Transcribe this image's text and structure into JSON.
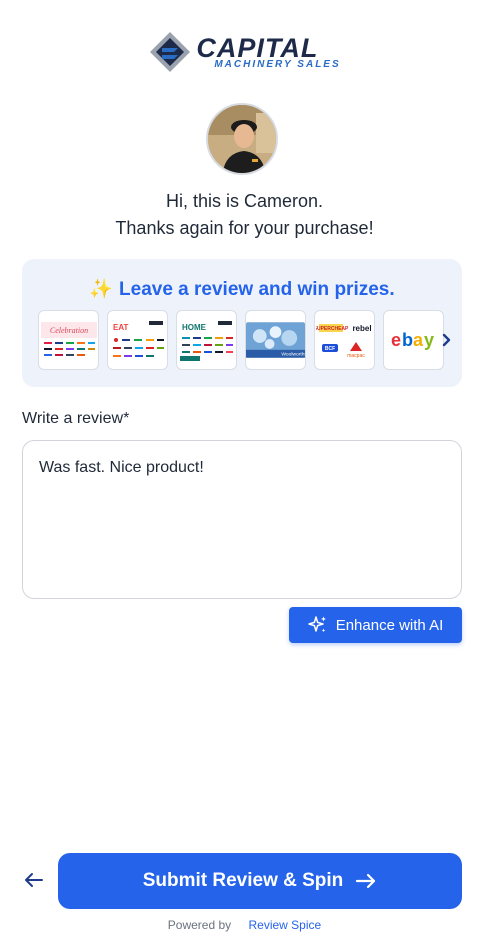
{
  "brand": {
    "logo_word": "CAPITAL",
    "logo_sub": "MACHINERY SALES"
  },
  "greeting": {
    "line1": "Hi, this is Cameron.",
    "line2": "Thanks again for your purchase!"
  },
  "prizes": {
    "heading": "Leave a review and win prizes.",
    "heading_icon": "sparkles-icon",
    "thumbnails": [
      {
        "name": "Celebration",
        "label": "Celebration"
      },
      {
        "name": "EAT",
        "label": "EAT"
      },
      {
        "name": "HOME",
        "label": "HOME"
      },
      {
        "name": "Woolworths",
        "label": "Woolworths"
      },
      {
        "name": "Supercheap / rebel",
        "label": "rebel"
      },
      {
        "name": "ebay",
        "label": "ebay"
      }
    ],
    "next_icon": "chevron-right-icon"
  },
  "review": {
    "label": "Write a review*",
    "value": "Was fast. Nice product!"
  },
  "enhance_button": {
    "label": "Enhance with AI",
    "icon": "sparkles-icon"
  },
  "submit_button": {
    "label": "Submit Review & Spin",
    "icon": "arrow-right-icon"
  },
  "back_button": {
    "icon": "arrow-left-icon"
  },
  "footer": {
    "powered_by": "Powered by",
    "brand": "Review Spice"
  },
  "colors": {
    "accent": "#2563eb",
    "card_bg": "#eef3fb"
  }
}
